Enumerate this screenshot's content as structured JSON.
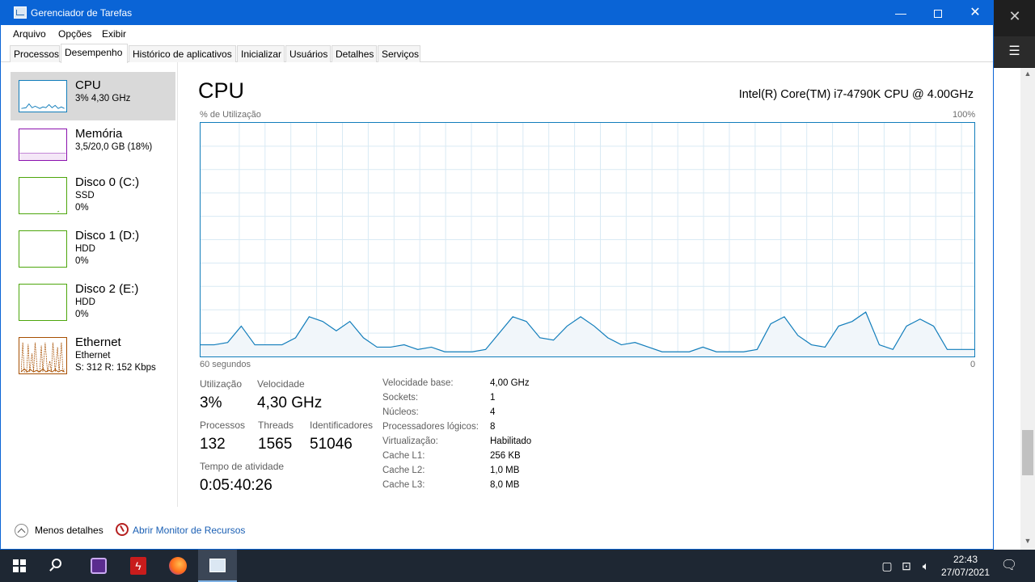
{
  "window": {
    "title": "Gerenciador de Tarefas",
    "controls": {
      "minimize": "—",
      "close": "✕"
    }
  },
  "menu": [
    "Arquivo",
    "Opções",
    "Exibir"
  ],
  "tabs": [
    "Processos",
    "Desempenho",
    "Histórico de aplicativos",
    "Inicializar",
    "Usuários",
    "Detalhes",
    "Serviços"
  ],
  "active_tab": "Desempenho",
  "sidebar": [
    {
      "title": "CPU",
      "lines": [
        "3% 4,30 GHz"
      ],
      "color": "#117dbb",
      "selected": true
    },
    {
      "title": "Memória",
      "lines": [
        "3,5/20,0 GB (18%)"
      ],
      "color": "#8b12ae",
      "selected": false
    },
    {
      "title": "Disco 0 (C:)",
      "lines": [
        "SSD",
        "0%"
      ],
      "color": "#4da60c",
      "selected": false
    },
    {
      "title": "Disco 1 (D:)",
      "lines": [
        "HDD",
        "0%"
      ],
      "color": "#4da60c",
      "selected": false
    },
    {
      "title": "Disco 2 (E:)",
      "lines": [
        "HDD",
        "0%"
      ],
      "color": "#4da60c",
      "selected": false
    },
    {
      "title": "Ethernet",
      "lines": [
        "Ethernet",
        "S: 312  R: 152 Kbps"
      ],
      "color": "#a74f01",
      "selected": false
    }
  ],
  "main": {
    "title": "CPU",
    "model": "Intel(R) Core(TM) i7-4790K CPU @ 4.00GHz",
    "graph_label_left": "% de Utilização",
    "graph_label_max": "100%",
    "graph_label_time": "60 segundos",
    "graph_label_min": "0",
    "graph_color": "#117dbb",
    "utilization_history": [
      5,
      5,
      6,
      13,
      5,
      5,
      5,
      8,
      17,
      15,
      11,
      15,
      8,
      4,
      4,
      5,
      3,
      4,
      2,
      2,
      2,
      3,
      10,
      17,
      15,
      8,
      7,
      13,
      17,
      13,
      8,
      5,
      6,
      4,
      2,
      2,
      2,
      4,
      2,
      2,
      2,
      3,
      14,
      17,
      9,
      5,
      4,
      13,
      15,
      19,
      5,
      3,
      13,
      16,
      13,
      3,
      3,
      3
    ]
  },
  "stats": {
    "utilizacao_label": "Utilização",
    "utilizacao": "3%",
    "velocidade_label": "Velocidade",
    "velocidade": "4,30 GHz",
    "processos_label": "Processos",
    "processos": "132",
    "threads_label": "Threads",
    "threads": "1565",
    "ident_label": "Identificadores",
    "ident": "51046",
    "tempo_label": "Tempo de atividade",
    "tempo": "0:05:40:26"
  },
  "specs": [
    {
      "k": "Velocidade base:",
      "v": "4,00 GHz"
    },
    {
      "k": "Sockets:",
      "v": "1"
    },
    {
      "k": "Núcleos:",
      "v": "4"
    },
    {
      "k": "Processadores lógicos:",
      "v": "8"
    },
    {
      "k": "Virtualização:",
      "v": "Habilitado"
    },
    {
      "k": "Cache L1:",
      "v": "256 KB"
    },
    {
      "k": "Cache L2:",
      "v": "1,0 MB"
    },
    {
      "k": "Cache L3:",
      "v": "8,0 MB"
    }
  ],
  "footer": {
    "less": "Menos detalhes",
    "monitor": "Abrir Monitor de Recursos"
  },
  "taskbar": {
    "time": "22:43",
    "date": "27/07/2021"
  }
}
